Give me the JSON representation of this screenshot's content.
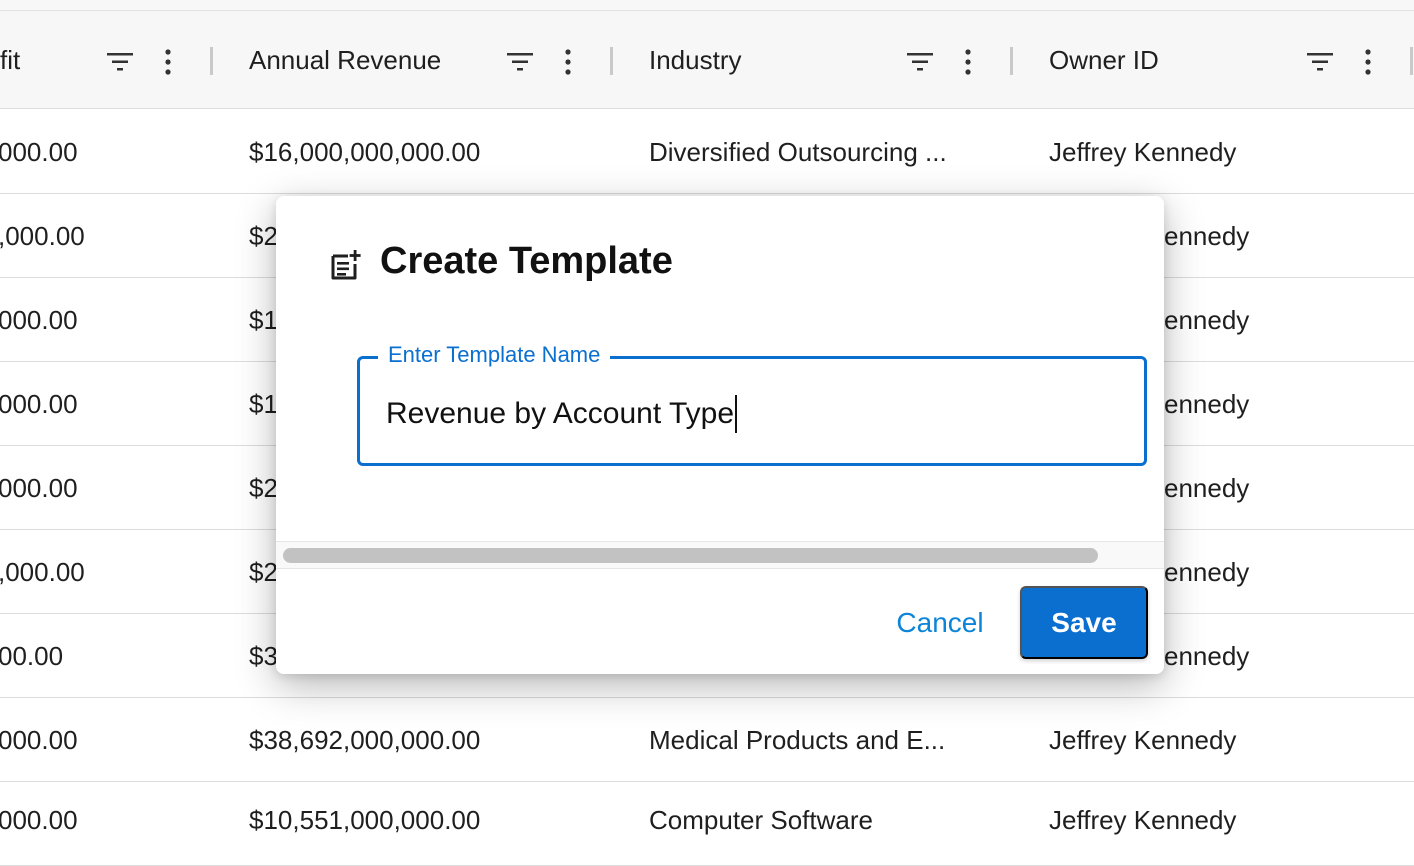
{
  "table": {
    "columns": [
      {
        "label": "fit"
      },
      {
        "label": "Annual Revenue"
      },
      {
        "label": "Industry"
      },
      {
        "label": "Owner ID"
      }
    ],
    "rows": [
      {
        "profit": "000.00",
        "revenue": "$16,000,000,000.00",
        "industry": "Diversified Outsourcing ...",
        "owner": "Jeffrey Kennedy"
      },
      {
        "profit": ",000.00",
        "revenue": "$2",
        "industry": "",
        "owner": "ennedy"
      },
      {
        "profit": "000.00",
        "revenue": "$1",
        "industry": "",
        "owner": "ennedy"
      },
      {
        "profit": "000.00",
        "revenue": "$1",
        "industry": "",
        "owner": "ennedy"
      },
      {
        "profit": "000.00",
        "revenue": "$2",
        "industry": "",
        "owner": "ennedy"
      },
      {
        "profit": ",000.00",
        "revenue": "$2",
        "industry": "",
        "owner": "ennedy"
      },
      {
        "profit": "00.00",
        "revenue": "$3",
        "industry": "",
        "owner": "ennedy"
      },
      {
        "profit": "000.00",
        "revenue": "$38,692,000,000.00",
        "industry": "Medical Products and E...",
        "owner": "Jeffrey Kennedy"
      },
      {
        "profit": "000.00",
        "revenue": "$10,551,000,000.00",
        "industry": "Computer Software",
        "owner": "Jeffrey Kennedy"
      }
    ]
  },
  "dialog": {
    "title": "Create Template",
    "field_label": "Enter Template Name",
    "field_value": "Revenue by Account Type",
    "cancel_label": "Cancel",
    "save_label": "Save"
  },
  "colors": {
    "accent": "#0b6fd0",
    "link": "#0b84d9"
  },
  "icons": {
    "header_filter": "filter-icon",
    "header_menu": "kebab-menu-icon",
    "dialog": "add-note-icon"
  }
}
